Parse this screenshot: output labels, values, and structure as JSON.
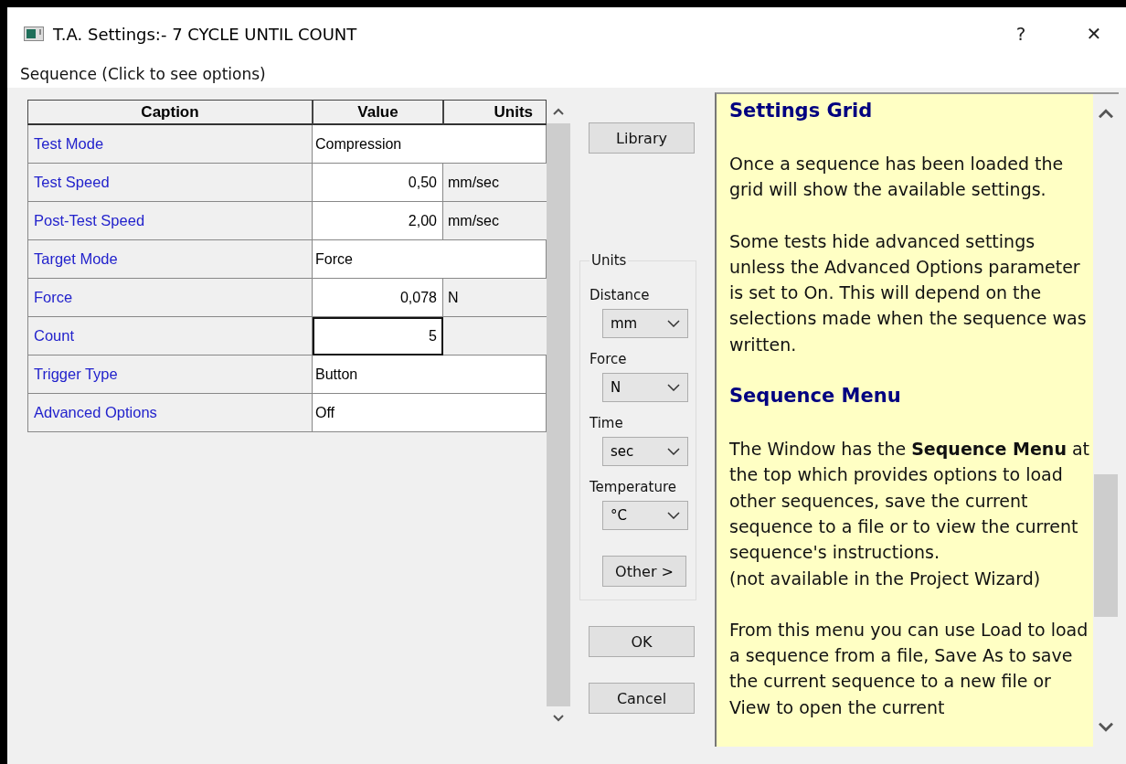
{
  "window": {
    "title": "T.A. Settings:- 7 CYCLE UNTIL COUNT",
    "help_button": "?",
    "close_button": "✕"
  },
  "menu": "Sequence (Click to see options)",
  "grid": {
    "columns": [
      "Caption",
      "Value",
      "Units"
    ],
    "rows": [
      {
        "caption": "Test Mode",
        "value": "Compression",
        "kind": "text",
        "focused": false
      },
      {
        "caption": "Test Speed",
        "value": "0,50",
        "units": "mm/sec",
        "kind": "number",
        "focused": false
      },
      {
        "caption": "Post-Test Speed",
        "value": "2,00",
        "units": "mm/sec",
        "kind": "number",
        "focused": false
      },
      {
        "caption": "Target Mode",
        "value": "Force",
        "kind": "text",
        "focused": false
      },
      {
        "caption": "Force",
        "value": "0,078",
        "units": "N",
        "kind": "number",
        "focused": false
      },
      {
        "caption": "Count",
        "value": "5",
        "kind": "number",
        "focused": true
      },
      {
        "caption": "Trigger Type",
        "value": "Button",
        "kind": "text",
        "focused": false
      },
      {
        "caption": "Advanced Options",
        "value": "Off",
        "kind": "text",
        "focused": false
      }
    ]
  },
  "library_button": "Library",
  "units": {
    "title": "Units",
    "fields": [
      {
        "label": "Distance",
        "value": "mm"
      },
      {
        "label": "Force",
        "value": "N"
      },
      {
        "label": "Time",
        "value": "sec"
      },
      {
        "label": "Temperature",
        "value": "°C"
      }
    ],
    "other_button": "Other  >"
  },
  "ok_button": "OK",
  "cancel_button": "Cancel",
  "help": [
    {
      "kind": "heading",
      "text": "Settings Grid"
    },
    {
      "kind": "paragraph",
      "text": "Once a sequence has been loaded the grid will show the available settings."
    },
    {
      "kind": "paragraph",
      "text": "Some tests hide advanced settings unless the Advanced Options parameter is set to On. This will depend on the selections made when the sequence was written."
    },
    {
      "kind": "heading",
      "text": "Sequence Menu"
    },
    {
      "kind": "paragraph",
      "text": "The Window has the **Sequence Menu** at the top which provides options to load other sequences, save the current sequence to a file or to view the current sequence's instructions.\n(not available in the Project Wizard)"
    },
    {
      "kind": "paragraph",
      "text": "From this menu you can use Load to load a sequence from a file, Save As to save the current sequence to a new file or View to open the current"
    }
  ]
}
